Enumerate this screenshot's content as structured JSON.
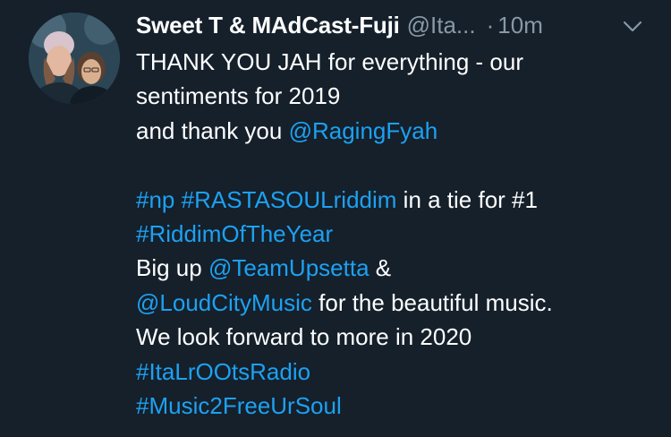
{
  "tweet": {
    "display_name": "Sweet T & MAdCast-Fuji",
    "handle": "@Ita...",
    "separator": "·",
    "time": "10m",
    "menu_icon": "chevron-down-icon",
    "avatar_icon": "profile-photo",
    "lines": [
      [
        {
          "text": "THANK YOU JAH for everything - our"
        }
      ],
      [
        {
          "text": "sentiments for 2019"
        }
      ],
      [
        {
          "text": "and thank you "
        },
        {
          "text": "@RagingFyah",
          "link": true
        }
      ],
      [],
      [
        {
          "text": "#np",
          "link": true
        },
        {
          "text": " "
        },
        {
          "text": "#RASTASOULriddim",
          "link": true
        },
        {
          "text": " in a tie for #1"
        }
      ],
      [
        {
          "text": "#RiddimOfTheYear",
          "link": true
        }
      ],
      [
        {
          "text": "Big up "
        },
        {
          "text": "@TeamUpsetta",
          "link": true
        },
        {
          "text": " &"
        }
      ],
      [
        {
          "text": "@LoudCityMusic",
          "link": true
        },
        {
          "text": " for the beautiful music."
        }
      ],
      [
        {
          "text": "We look forward to more in 2020"
        }
      ],
      [
        {
          "text": "#ItaLrOOtsRadio",
          "link": true
        }
      ],
      [
        {
          "text": "#Music2FreeUrSoul",
          "link": true
        }
      ]
    ]
  },
  "colors": {
    "background": "#15202b",
    "text": "#ffffff",
    "secondary": "#8899a6",
    "link": "#1da1f2"
  }
}
